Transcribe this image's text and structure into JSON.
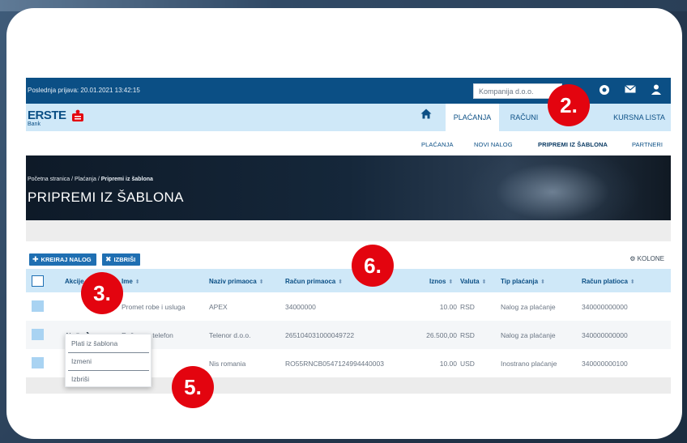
{
  "topbar": {
    "last_login": "Poslednja prijava: 20.01.2021 13:42:15",
    "company_value": "Kompanija d.o.o."
  },
  "brand": {
    "name": "ERSTE",
    "sub": "Bank"
  },
  "nav": {
    "tabs": [
      {
        "label": "PLAĆANJA",
        "active": true
      },
      {
        "label": "RAČUNI",
        "active": false
      },
      {
        "label": "KURSNA LISTA",
        "active": false
      }
    ]
  },
  "subnav": {
    "items": [
      {
        "label": "PLAĆANJA",
        "active": false
      },
      {
        "label": "NOVI NALOG",
        "active": false
      },
      {
        "label": "PRIPREMI IZ ŠABLONA",
        "active": true
      },
      {
        "label": "PARTNERI",
        "active": false
      }
    ]
  },
  "hero": {
    "breadcrumb": [
      "Početna stranica",
      "Plaćanja",
      "Pripremi iz šablona"
    ],
    "title": "PRIPREMI IZ ŠABLONA"
  },
  "toolbar": {
    "create_label": "KREIRAJ NALOG",
    "delete_label": "IZBRIŠI",
    "columns_label": "KOLONE"
  },
  "table": {
    "columns": [
      "Akcije",
      "Ime",
      "Naziv primaoca",
      "Račun primaoca",
      "Iznos",
      "Valuta",
      "Tip plaćanja",
      "Račun platioca"
    ],
    "rows": [
      {
        "akcije": "",
        "ime": "Promet robe i usluga",
        "naziv": "APEX",
        "racun_primaoca": "34000000",
        "iznos": "10.00",
        "valuta": "RSD",
        "tip": "Nalog za plaćanje",
        "racun_platioca": "340000000000"
      },
      {
        "akcije": "Akcije",
        "ime": "Račun za telefon",
        "naziv": "Telenor d.o.o.",
        "racun_primaoca": "265104031000049722",
        "iznos": "26.500,00",
        "valuta": "RSD",
        "tip": "Nalog za plaćanje",
        "racun_platioca": "340000000000"
      },
      {
        "akcije": "",
        "ime": "",
        "naziv": "Nis romania",
        "racun_primaoca": "RO55RNCB0547124994440003",
        "iznos": "10.00",
        "valuta": "USD",
        "tip": "Inostrano plaćanje",
        "racun_platioca": "340000000100"
      }
    ]
  },
  "dropdown": {
    "items": [
      "Plati iz šablona",
      "Izmeni",
      "Izbriši"
    ]
  },
  "markers": [
    "2.",
    "3.",
    "5.",
    "6."
  ],
  "colors": {
    "primary": "#0b4f85",
    "nav_bg": "#cfe8f8",
    "button": "#1f6fb2",
    "marker": "#e3040f",
    "logo_red": "#e3040f"
  },
  "icons": [
    "home-icon",
    "plus-icon",
    "x-icon",
    "gear-icon",
    "mail-icon",
    "user-icon",
    "settings-icon",
    "sort-icon",
    "chevron-right-icon"
  ]
}
